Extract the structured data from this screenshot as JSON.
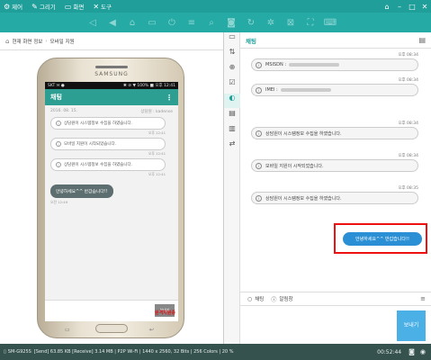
{
  "menu": [
    {
      "icon": "gear-icon",
      "glyph": "⚙",
      "label": "제어"
    },
    {
      "icon": "pen-icon",
      "glyph": "✎",
      "label": "그리기"
    },
    {
      "icon": "monitor-icon",
      "glyph": "▭",
      "label": "화면"
    },
    {
      "icon": "tools-icon",
      "glyph": "✕",
      "label": "도구"
    }
  ],
  "window": {
    "pin": "⌂",
    "minimize": "–",
    "maximize": "□",
    "close": "✕"
  },
  "breadcrumb": {
    "current": "현재 화면 정보",
    "sep": "›",
    "page": "모바일 지원"
  },
  "phone": {
    "brand": "SAMSUNG",
    "status_left": "SKT ✉ ●",
    "status_right": "✱ ⊘ ▼ 100% ■ 오후 12:41",
    "app_title": "채팅",
    "date": "2016. 08. 15.",
    "agent": "상담원 : kadense",
    "messages": [
      {
        "text": "상담원이 시스템정보 수집을 하였습니다.",
        "time": "오후 12:41"
      },
      {
        "text": "모바일 지원이 시작되었습니다.",
        "time": "오후 12:41"
      },
      {
        "text": "상담원이 시스템정보 수집을 하였습니다.",
        "time": "오후 12:41"
      }
    ],
    "greeting": "안녕하세요^^ 반갑습니다!!",
    "greeting_time": "오전 12:49",
    "send_label": "보내기",
    "watermark": "원격지원중"
  },
  "chat": {
    "title": "채팅",
    "messages": [
      {
        "label": "MSISDN :",
        "time": "오후 08:34"
      },
      {
        "label": "IMEI :",
        "time": "오후 08:34"
      },
      {
        "label": "상담원이 시스템정보 수집을 하였습니다.",
        "time": "오후 08:34"
      },
      {
        "label": "모바일 지원이 시작되었습니다.",
        "time": "오후 08:34"
      },
      {
        "label": "상담원이 시스템정보 수집을 하였습니다.",
        "time": "오후 08:35"
      }
    ],
    "my_message": "안녕하세요^^ 반갑습니다!!",
    "tabs": [
      {
        "icon": "chat-icon",
        "glyph": "○",
        "label": "채팅"
      },
      {
        "icon": "info-icon",
        "glyph": "ⓘ",
        "label": "알림창"
      }
    ],
    "send": "보내기"
  },
  "sidebar_icons": [
    "▭",
    "⇅",
    "⊕",
    "☑",
    "◐",
    "▤",
    "▥",
    "⇄"
  ],
  "statusbar": {
    "device": "SM-G925S",
    "info": "[Send] 63.85 KB  [Receive] 3.14 MB | P2P Wi-Fi | 1440 x 2560, 32 Bits | 256 Colors | 20 %",
    "clock": "00:52:44"
  }
}
